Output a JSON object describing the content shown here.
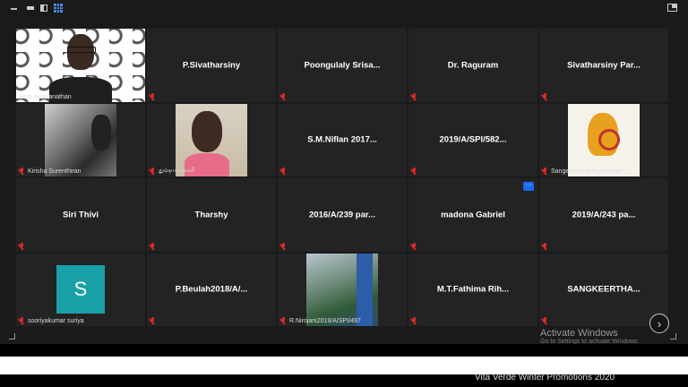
{
  "participants": [
    {
      "id": "arun",
      "name": "Arun Ayokianathan",
      "type": "video",
      "active": true
    },
    {
      "id": "p1",
      "name": "P.Sivatharsiny",
      "type": "name"
    },
    {
      "id": "p2",
      "name": "Poongulaly  Srisa...",
      "type": "name"
    },
    {
      "id": "p3",
      "name": "Dr. Raguram",
      "type": "name"
    },
    {
      "id": "p4",
      "name": "Sivatharsiny  Par...",
      "type": "name"
    },
    {
      "id": "kirisha",
      "name": "Kirisha Surenthiran",
      "type": "video"
    },
    {
      "id": "tamil",
      "name": "துஷாபாலனி",
      "type": "video"
    },
    {
      "id": "p7",
      "name": "S.M.Niflan  2017...",
      "type": "name"
    },
    {
      "id": "p8",
      "name": "2019/A/SPI/582...",
      "type": "name"
    },
    {
      "id": "sangeerthana",
      "name": "Sangeerthana Purendran",
      "type": "video"
    },
    {
      "id": "p10",
      "name": "Siri Thivi",
      "type": "name"
    },
    {
      "id": "p11",
      "name": "Tharshy",
      "type": "name"
    },
    {
      "id": "p12",
      "name": "2016/A/239 par...",
      "type": "name"
    },
    {
      "id": "p13",
      "name": "madona Gabriel",
      "type": "name",
      "more": true
    },
    {
      "id": "p14",
      "name": "2019/A/243 pa...",
      "type": "name"
    },
    {
      "id": "sooriya",
      "name": "sooriyakumar suriya",
      "type": "avatar",
      "avatar_letter": "S"
    },
    {
      "id": "p16",
      "name": "P.Beulah2018/A/...",
      "type": "name"
    },
    {
      "id": "nirojani",
      "name": "R.Nirojani2019/A/SPI/497",
      "type": "video"
    },
    {
      "id": "p18",
      "name": "M.T.Fathima  Rih...",
      "type": "name"
    },
    {
      "id": "p19",
      "name": "SANGKEERTHA...",
      "type": "name"
    }
  ],
  "more_button": "···",
  "next_button": "›",
  "watermark": {
    "title": "Activate Windows",
    "subtitle": "Go to Settings to activate Windows."
  },
  "promo_text": "Vita Verde Winter Promotions 2020",
  "colors": {
    "active_border": "#e4d64d",
    "muted_mic": "#e02828",
    "avatar_bg": "#1aa0a8",
    "accent": "#1a6cf0"
  }
}
